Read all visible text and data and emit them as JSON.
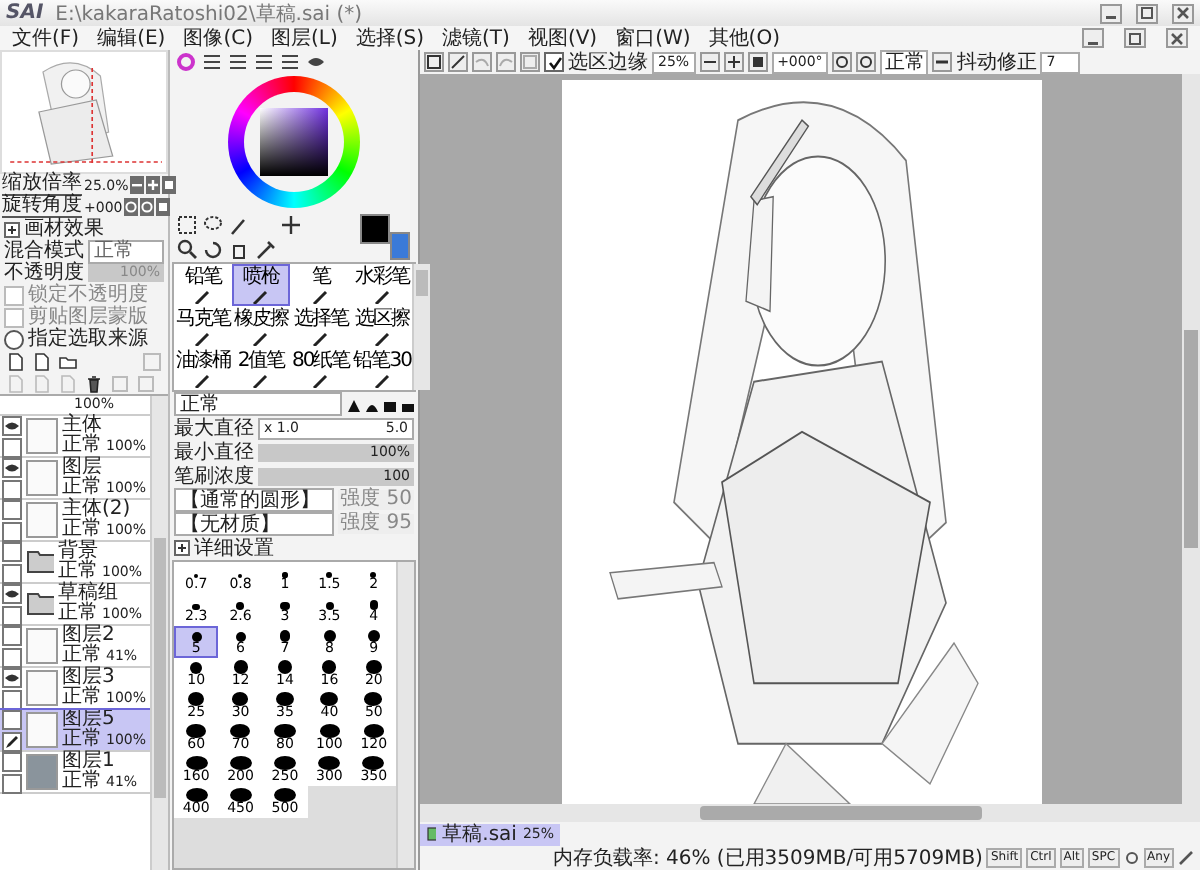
{
  "window": {
    "logo": "SAI",
    "title": "E:\\kakaraRatoshi02\\草稿.sai (*)"
  },
  "menu": [
    "文件(F)",
    "编辑(E)",
    "图像(C)",
    "图层(L)",
    "选择(S)",
    "滤镜(T)",
    "视图(V)",
    "窗口(W)",
    "其他(O)"
  ],
  "toolbar": {
    "edge": {
      "label": "选区边缘",
      "checked": true
    },
    "zoom": "25%",
    "rotation": "+000°",
    "blend": "正常",
    "stabilizer_label": "抖动修正",
    "stabilizer": "7"
  },
  "navigator": {
    "zoom_label": "缩放倍率",
    "zoom": "25.0%",
    "rotate_label": "旋转角度",
    "rotate": "+000"
  },
  "layer_props": {
    "effect": "画材效果",
    "blend_label": "混合模式",
    "blend": "正常",
    "opacity_label": "不透明度",
    "opacity": {
      "value": "100%",
      "level": 1
    },
    "options": [
      {
        "label": "锁定不透明度",
        "checked": false,
        "disabled": true
      },
      {
        "label": "剪贴图层蒙版",
        "checked": false,
        "disabled": true
      }
    ],
    "source": {
      "label": "指定选取来源",
      "selected": false
    }
  },
  "layers": [
    {
      "kind": "partial",
      "opacity": "100%"
    },
    {
      "kind": "layer",
      "name": "主体",
      "mode": "正常",
      "opacity": "100%",
      "visible": true,
      "selected": false
    },
    {
      "kind": "layer",
      "name": "图层",
      "mode": "正常",
      "opacity": "100%",
      "visible": true,
      "selected": false
    },
    {
      "kind": "layer",
      "name": "主体(2)",
      "mode": "正常",
      "opacity": "100%",
      "visible": false,
      "selected": false
    },
    {
      "kind": "folder",
      "name": "背景",
      "mode": "正常",
      "opacity": "100%",
      "visible": false,
      "selected": false
    },
    {
      "kind": "folder",
      "name": "草稿组",
      "mode": "正常",
      "opacity": "100%",
      "visible": true,
      "selected": false
    },
    {
      "kind": "layer",
      "name": "图层2",
      "mode": "正常",
      "opacity": "41%",
      "visible": false,
      "selected": false
    },
    {
      "kind": "layer",
      "name": "图层3",
      "mode": "正常",
      "opacity": "100%",
      "visible": true,
      "selected": false
    },
    {
      "kind": "layer",
      "name": "图层5",
      "mode": "正常",
      "opacity": "100%",
      "visible": false,
      "selected": true
    },
    {
      "kind": "layer",
      "name": "图层1",
      "mode": "正常",
      "opacity": "41%",
      "visible": false,
      "selected": false
    }
  ],
  "brushes": [
    {
      "name": "铅笔",
      "selected": false
    },
    {
      "name": "喷枪",
      "selected": true
    },
    {
      "name": "笔",
      "selected": false
    },
    {
      "name": "水彩笔",
      "selected": false
    },
    {
      "name": "马克笔",
      "selected": false
    },
    {
      "name": "橡皮擦",
      "selected": false
    },
    {
      "name": "选择笔",
      "selected": false
    },
    {
      "name": "选区擦",
      "selected": false
    },
    {
      "name": "油漆桶",
      "selected": false
    },
    {
      "name": "2值笔",
      "selected": false
    },
    {
      "name": "80纸笔",
      "selected": false
    },
    {
      "name": "铅笔30",
      "selected": false
    }
  ],
  "brush": {
    "blend": "正常",
    "max_label": "最大直径",
    "max_mult": "x 1.0",
    "max": "5.0",
    "min": {
      "label": "最小直径",
      "value": "100%",
      "level": 1
    },
    "density": {
      "label": "笔刷浓度",
      "value": "100",
      "level": 1
    },
    "shape": "【通常的圆形】",
    "shape_strength_label": "强度",
    "shape_strength": "50",
    "texture": "【无材质】",
    "texture_strength_label": "强度",
    "texture_strength": "95",
    "detail": "详细设置"
  },
  "sizes": [
    {
      "label": "0.7",
      "selected": false
    },
    {
      "label": "0.8",
      "selected": false
    },
    {
      "label": "1",
      "selected": false
    },
    {
      "label": "1.5",
      "selected": false
    },
    {
      "label": "2",
      "selected": false
    },
    {
      "label": "2.3",
      "selected": false
    },
    {
      "label": "2.6",
      "selected": false
    },
    {
      "label": "3",
      "selected": false
    },
    {
      "label": "3.5",
      "selected": false
    },
    {
      "label": "4",
      "selected": false
    },
    {
      "label": "5",
      "selected": true
    },
    {
      "label": "6",
      "selected": false
    },
    {
      "label": "7",
      "selected": false
    },
    {
      "label": "8",
      "selected": false
    },
    {
      "label": "9",
      "selected": false
    },
    {
      "label": "10",
      "selected": false
    },
    {
      "label": "12",
      "selected": false
    },
    {
      "label": "14",
      "selected": false
    },
    {
      "label": "16",
      "selected": false
    },
    {
      "label": "20",
      "selected": false
    },
    {
      "label": "25",
      "selected": false
    },
    {
      "label": "30",
      "selected": false
    },
    {
      "label": "35",
      "selected": false
    },
    {
      "label": "40",
      "selected": false
    },
    {
      "label": "50",
      "selected": false
    },
    {
      "label": "60",
      "selected": false
    },
    {
      "label": "70",
      "selected": false
    },
    {
      "label": "80",
      "selected": false
    },
    {
      "label": "100",
      "selected": false
    },
    {
      "label": "120",
      "selected": false
    },
    {
      "label": "160",
      "selected": false
    },
    {
      "label": "200",
      "selected": false
    },
    {
      "label": "250",
      "selected": false
    },
    {
      "label": "300",
      "selected": false
    },
    {
      "label": "350",
      "selected": false
    },
    {
      "label": "400",
      "selected": false
    },
    {
      "label": "450",
      "selected": false
    },
    {
      "label": "500",
      "selected": false
    }
  ],
  "status": {
    "doc": {
      "name": "草稿.sai",
      "zoom": "25%",
      "selected": true
    },
    "memory": "内存负载率: 46% (已用3509MB/可用5709MB)",
    "keys": [
      "Shift",
      "Ctrl",
      "Alt",
      "SPC"
    ],
    "any": "Any"
  }
}
